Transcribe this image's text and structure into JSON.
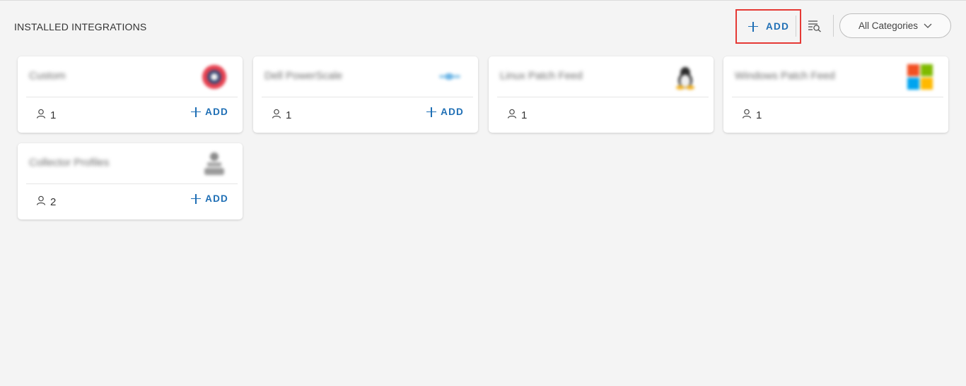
{
  "header": {
    "title": "INSTALLED INTEGRATIONS",
    "add_label": "ADD",
    "category_selected": "All Categories",
    "icons": {
      "add": "plus-icon",
      "filter": "filter-search-icon",
      "dropdown": "chevron-down-icon"
    }
  },
  "cards": [
    {
      "title": "Custom",
      "count": "1",
      "add_label": "ADD",
      "logo": "custom-logo-icon"
    },
    {
      "title": "Dell PowerScale",
      "count": "1",
      "add_label": "ADD",
      "logo": "dell-logo-icon"
    },
    {
      "title": "Linux Patch Feed",
      "count": "1",
      "logo": "linux-logo-icon"
    },
    {
      "title": "Windows Patch Feed",
      "count": "1",
      "logo": "windows-logo-icon"
    },
    {
      "title": "Collector Profiles",
      "count": "2",
      "add_label": "ADD",
      "logo": "collector-logo-icon"
    }
  ],
  "colors": {
    "accent": "#1f6fb5",
    "highlight": "#e53935",
    "background": "#f4f4f4",
    "card": "#ffffff"
  }
}
